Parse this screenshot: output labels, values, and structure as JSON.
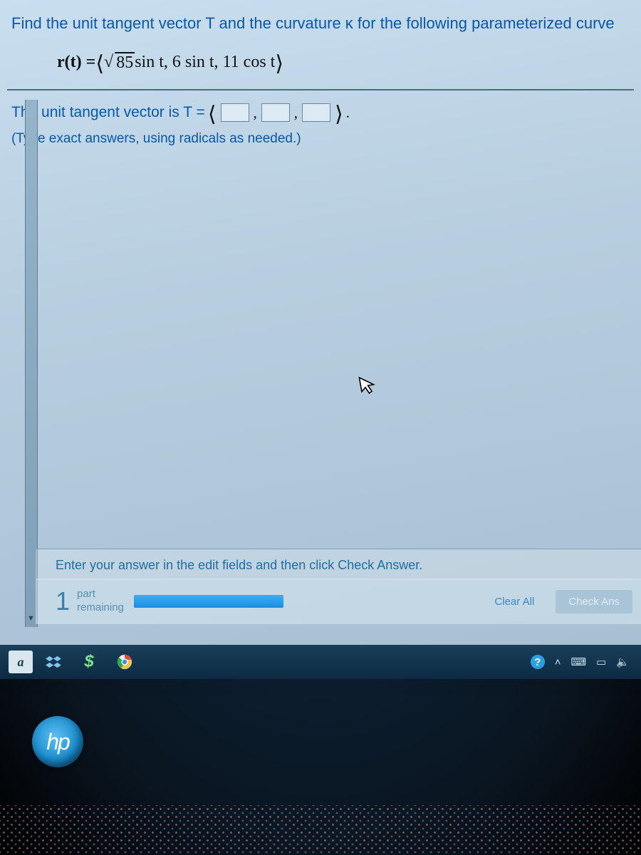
{
  "question": {
    "prompt_line": "Find the unit tangent vector T and the curvature κ for the following parameterized curve",
    "equation_prefix": "r(t) = ",
    "equation_open": "⟨",
    "equation_sqrt_value": "85",
    "equation_body": " sin t, 6 sin t, 11 cos t",
    "equation_close": "⟩",
    "answer_label_pre": "The unit tangent vector is T = ",
    "answer_open": "⟨",
    "answer_sep1": ",",
    "answer_sep2": ",",
    "answer_close": "⟩",
    "answer_period": ".",
    "hint": "(Type exact answers, using radicals as needed.)"
  },
  "footer": {
    "instruction": "Enter your answer in the edit fields and then click Check Answer.",
    "part_number": "1",
    "part_label_top": "part",
    "part_label_bottom": "remaining",
    "clear_label": "Clear All",
    "check_label": "Check Ans"
  },
  "taskbar": {
    "app_letter": "a"
  },
  "brand": {
    "hp": "hp"
  },
  "icons": {
    "dropbox": "⠿",
    "dollar": "$",
    "chrome": "◉",
    "help": "?",
    "chevron_up": "˄",
    "keyboard": "⌨",
    "battery": "▭",
    "volume": "🔈"
  }
}
